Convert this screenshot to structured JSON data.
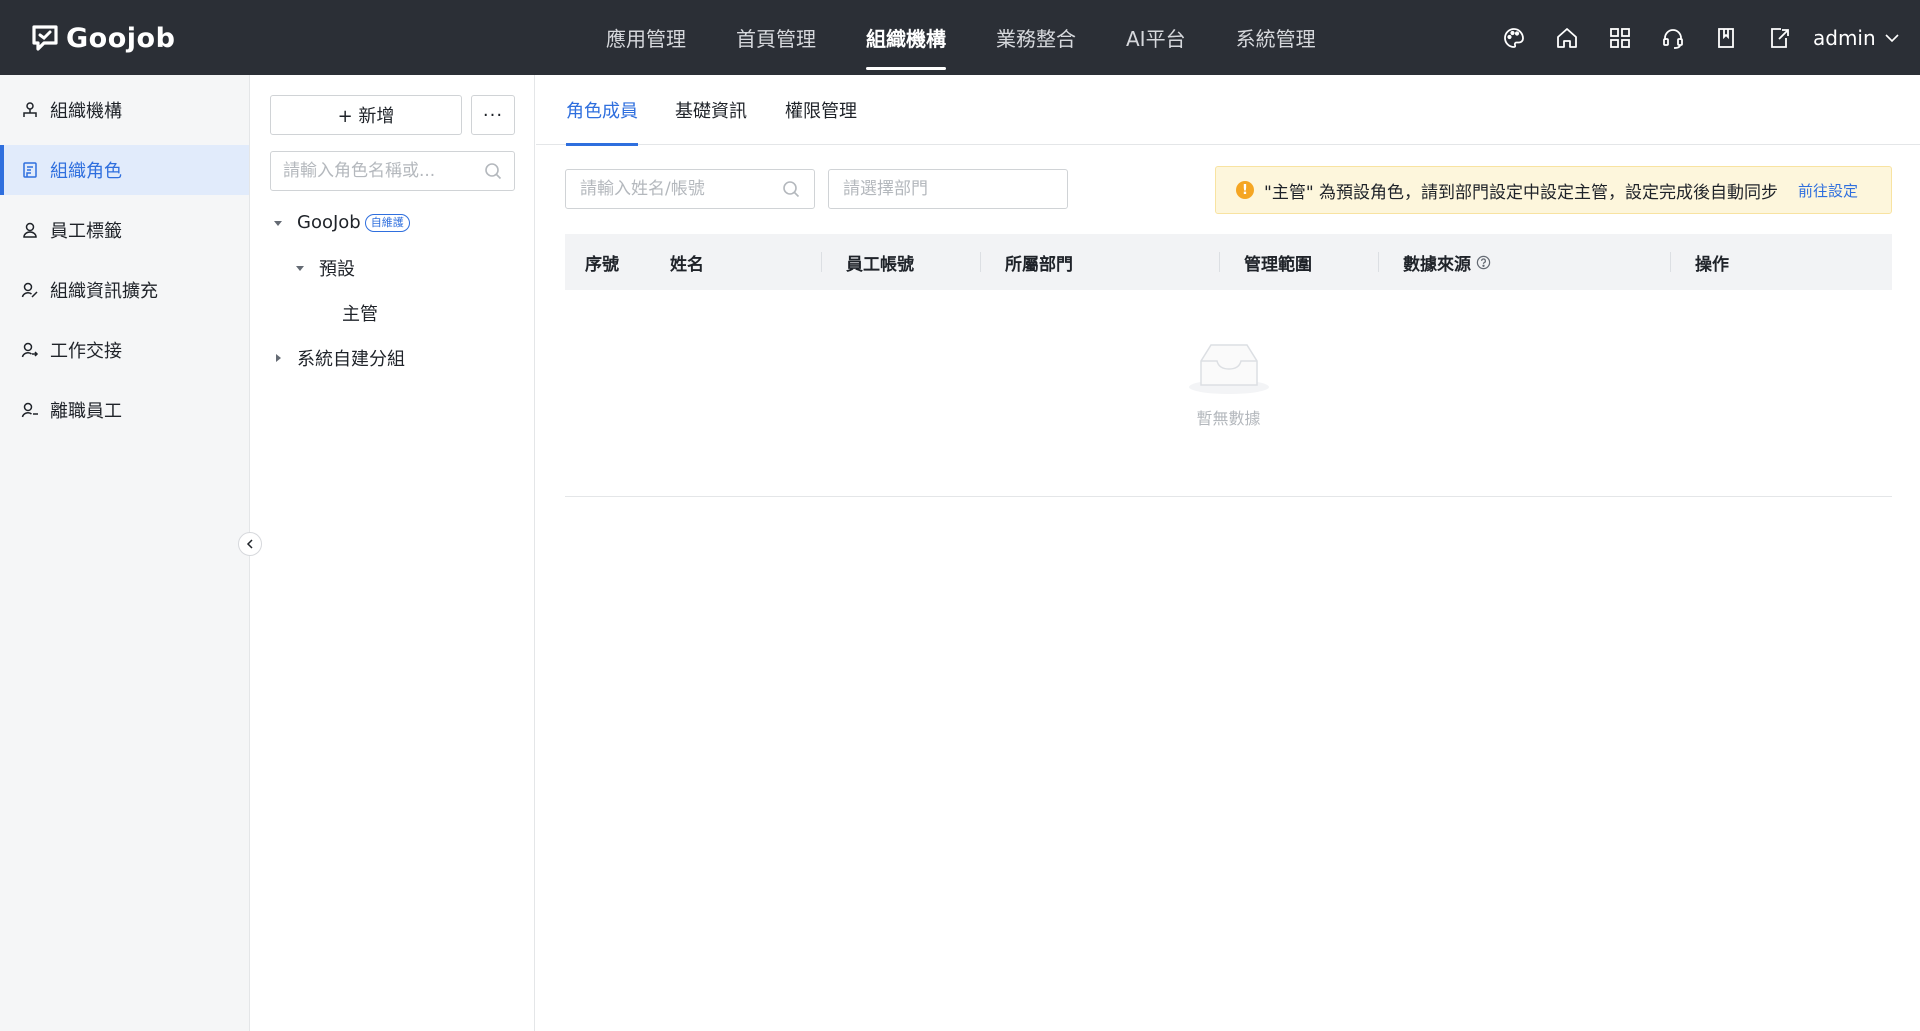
{
  "app": {
    "brand": "Goojob"
  },
  "topnav": {
    "items": [
      {
        "label": "應用管理"
      },
      {
        "label": "首頁管理"
      },
      {
        "label": "組織機構"
      },
      {
        "label": "業務整合"
      },
      {
        "label": "AI平台"
      },
      {
        "label": "系統管理"
      }
    ],
    "active_index": 2,
    "icons": [
      "palette-icon",
      "home-icon",
      "apps-grid-icon",
      "support-headset-icon",
      "book-icon",
      "export-icon"
    ],
    "user": "admin"
  },
  "sidebar": {
    "items": [
      {
        "label": "組織機構",
        "icon": "org-tree-icon"
      },
      {
        "label": "組織角色",
        "icon": "role-doc-icon"
      },
      {
        "label": "員工標籤",
        "icon": "tag-user-icon"
      },
      {
        "label": "組織資訊擴充",
        "icon": "user-edit-icon"
      },
      {
        "label": "工作交接",
        "icon": "user-transfer-icon"
      },
      {
        "label": "離職員工",
        "icon": "user-leave-icon"
      }
    ],
    "active_index": 1
  },
  "tree_panel": {
    "add_label": "+ 新增",
    "more_label": "···",
    "search_placeholder": "請輸入角色名稱或...",
    "nodes": [
      {
        "label": "GooJob",
        "badge": "自維護",
        "level": 0,
        "expanded": true
      },
      {
        "label": "預設",
        "level": 1,
        "expanded": true
      },
      {
        "label": "主管",
        "level": 2
      },
      {
        "label": "系統自建分組",
        "level": 0,
        "expanded": false
      }
    ]
  },
  "main": {
    "tabs": [
      {
        "label": "角色成員"
      },
      {
        "label": "基礎資訊"
      },
      {
        "label": "權限管理"
      }
    ],
    "active_tab": 0,
    "name_search_placeholder": "請輸入姓名/帳號",
    "dept_placeholder": "請選擇部門",
    "notice": {
      "text": "\"主管\" 為預設角色，請到部門設定中設定主管，設定完成後自動同步",
      "link": "前往設定"
    },
    "table": {
      "columns": [
        "序號",
        "姓名",
        "員工帳號",
        "所屬部門",
        "管理範圍",
        "數據來源",
        "操作"
      ],
      "rows": [],
      "empty_text": "暫無數據"
    }
  },
  "colors": {
    "topbar_bg": "#2b2f36",
    "accent": "#2f6fde",
    "sidebar_bg": "#f5f6f7",
    "notice_bg": "#fdf6dc",
    "warn": "#f5a623"
  }
}
